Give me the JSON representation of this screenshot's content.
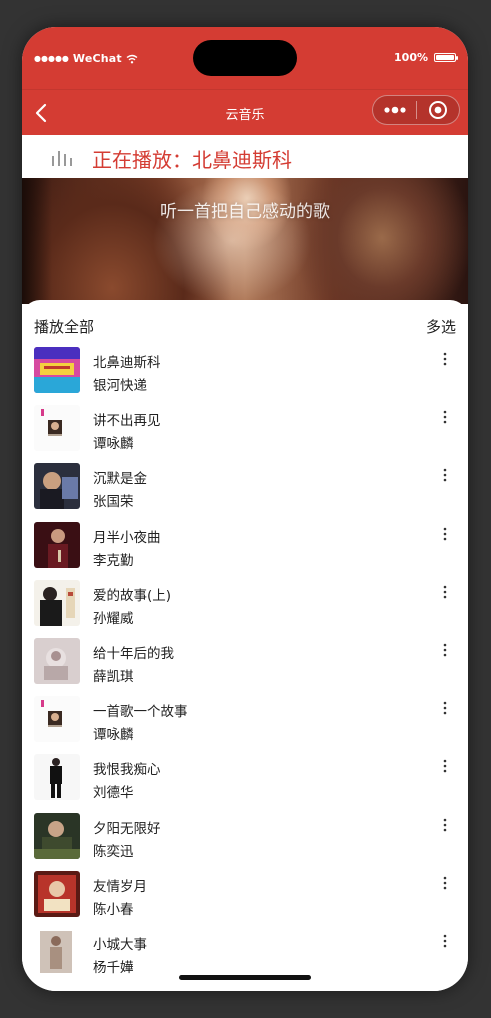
{
  "status": {
    "carrier": "WeChat",
    "signal_dots": "●●●●●",
    "battery_text": "100%",
    "battery_level": 1.0
  },
  "nav": {
    "title": "云音乐",
    "back_icon": "chevron-left-icon",
    "more_icon": "more-dots-icon",
    "close_icon": "target-close-icon"
  },
  "now_playing": {
    "icon": "equalizer-bars-icon",
    "text": "正在播放：北鼻迪斯科"
  },
  "banner": {
    "text": "听一首把自己感动的歌"
  },
  "list": {
    "play_all_label": "播放全部",
    "multi_select_label": "多选",
    "songs": [
      {
        "name": "北鼻迪斯科",
        "artist": "银河快递",
        "cover": "colorful"
      },
      {
        "name": "讲不出再见",
        "artist": "谭咏麟",
        "cover": "white-portrait"
      },
      {
        "name": "沉默是金",
        "artist": "张国荣",
        "cover": "dark-blue"
      },
      {
        "name": "月半小夜曲",
        "artist": "李克勤",
        "cover": "dark-red"
      },
      {
        "name": "爱的故事(上)",
        "artist": "孙耀威",
        "cover": "white-man"
      },
      {
        "name": "给十年后的我",
        "artist": "薛凯琪",
        "cover": "pale-pink"
      },
      {
        "name": "一首歌一个故事",
        "artist": "谭咏麟",
        "cover": "white-portrait"
      },
      {
        "name": "我恨我痴心",
        "artist": "刘德华",
        "cover": "white-standing"
      },
      {
        "name": "夕阳无限好",
        "artist": "陈奕迅",
        "cover": "green-dark"
      },
      {
        "name": "友情岁月",
        "artist": "陈小春",
        "cover": "red-poster"
      },
      {
        "name": "小城大事",
        "artist": "杨千嬅",
        "cover": "light-figure"
      }
    ]
  },
  "colors": {
    "brand_red": "#d43c33",
    "background": "#333333"
  }
}
